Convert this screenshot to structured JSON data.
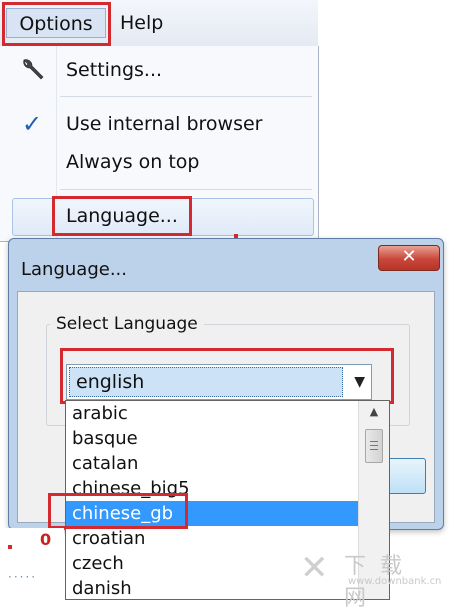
{
  "menubar": {
    "options_label": "Options",
    "help_label": "Help"
  },
  "options_menu": {
    "settings_label": "Settings...",
    "use_internal_browser_label": "Use internal browser",
    "use_internal_browser_checked": true,
    "always_on_top_label": "Always on top",
    "language_label": "Language..."
  },
  "dialog": {
    "title": "Language...",
    "close_glyph": "✕",
    "group_label": "Select Language",
    "selected_language": "english",
    "languages": [
      "arabic",
      "basque",
      "catalan",
      "chinese_big5",
      "chinese_gb",
      "croatian",
      "czech",
      "danish"
    ],
    "highlighted_language": "chinese_gb"
  },
  "background": {
    "counter_value": "0"
  },
  "watermark": {
    "chinese_text": "下载网",
    "url_text": "www.downbank.cn"
  },
  "colors": {
    "highlight_border": "#d42a2f",
    "selection_blue": "#3399ff",
    "dialog_frame": "#bcd1ea"
  },
  "icons": {
    "settings": "wrench-icon",
    "check": "checkmark-icon",
    "combo_arrow": "triangle-down-icon"
  }
}
